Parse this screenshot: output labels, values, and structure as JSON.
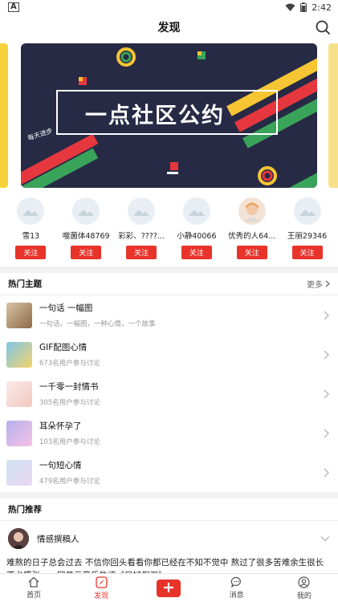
{
  "status_bar": {
    "time": "2:42"
  },
  "header": {
    "title": "发现"
  },
  "banner": {
    "title": "一点社区公约",
    "tag": "每天进步"
  },
  "users": [
    {
      "name": "雪13",
      "follow_label": "关注"
    },
    {
      "name": "噬菌体48769",
      "follow_label": "关注"
    },
    {
      "name": "彩彩、????...",
      "follow_label": "关注"
    },
    {
      "name": "小静40066",
      "follow_label": "关注"
    },
    {
      "name": "优秀的人64...",
      "follow_label": "关注"
    },
    {
      "name": "王丽29346",
      "follow_label": "关注"
    }
  ],
  "hot_topics": {
    "title": "热门主题",
    "more_label": "更多",
    "items": [
      {
        "title": "一句话 一幅图",
        "subtitle": "一句话，一幅图，一种心情，一个故事"
      },
      {
        "title": "GIF配图心情",
        "subtitle": "673名用户参与讨论"
      },
      {
        "title": "一千零一封情书",
        "subtitle": "305名用户参与讨论"
      },
      {
        "title": "耳朵怀孕了",
        "subtitle": "103名用户参与讨论"
      },
      {
        "title": "一句短心情",
        "subtitle": "479名用户参与讨论"
      }
    ]
  },
  "hot_recommend": {
    "title": "热门推荐",
    "post": {
      "author": "情感撰稿人",
      "text": "难熬的日子总会过去 不信你回头看看你都已经在不知不觉中 熬过了很多苦难余生很长 不必慌张——网易云音乐热评《只好假强》"
    }
  },
  "tabbar": {
    "home": "首页",
    "discover": "发现",
    "messages": "消息",
    "mine": "我的"
  },
  "colors": {
    "accent": "#e8332a",
    "banner_bg": "#272a45"
  }
}
